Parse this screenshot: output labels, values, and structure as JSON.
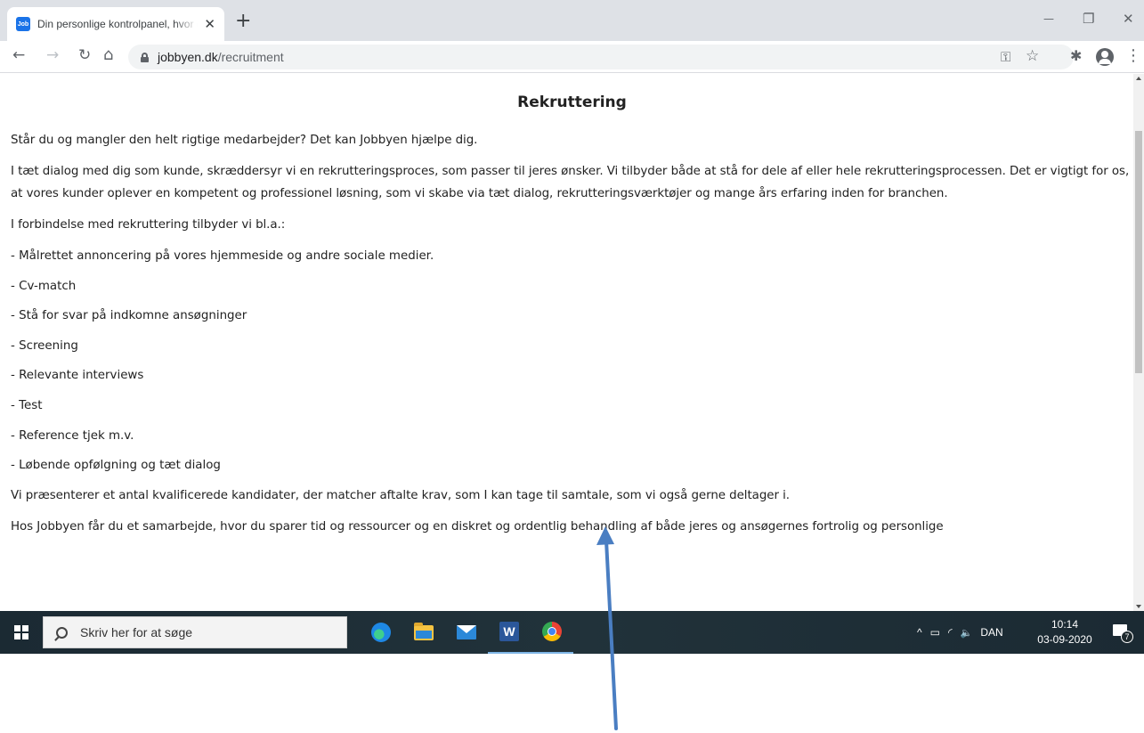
{
  "browser": {
    "tab": {
      "favicon_text": "Job",
      "title": "Din personlige kontrolpanel, hvor du kan",
      "close_glyph": "✕"
    },
    "new_tab_glyph": "+",
    "window_controls": {
      "minimize": "—",
      "restore": "❐",
      "close": "✕"
    },
    "toolbar": {
      "back_glyph": "←",
      "forward_glyph": "→",
      "reload_glyph": "↻",
      "home_glyph": "⌂",
      "url_domain": "jobbyen.dk",
      "url_path": "/recruitment",
      "key_glyph": "⚿",
      "star_glyph": "☆",
      "extensions_glyph": "✱",
      "menu_glyph": "⋮"
    }
  },
  "page": {
    "title": "Rekruttering",
    "intro": "Står du og mangler den helt rigtige medarbejder? Det kan Jobbyen hjælpe dig.",
    "description": "I tæt dialog med dig som kunde, skræddersyr vi en rekrutteringsproces, som passer til jeres ønsker. Vi tilbyder både at stå for dele af eller hele rekrutteringsprocessen. Det er vigtigt for os, at vores kunder oplever en kompetent og professionel løsning, som vi skabe via tæt dialog, rekrutteringsværktøjer og mange års erfaring inden for branchen.",
    "services_heading": "I forbindelse med rekruttering tilbyder vi bl.a.:",
    "services": [
      "- Målrettet annoncering på vores hjemmeside og andre sociale medier.",
      "- Cv-match",
      "- Stå for svar på indkomne ansøgninger",
      "- Screening",
      "- Relevante interviews",
      "- Test",
      "- Reference tjek m.v.",
      "- Løbende opfølgning og tæt dialog"
    ],
    "candidates": "Vi præsenterer et antal kvalificerede kandidater, der matcher aftalte krav, som I kan tage til samtale, som vi også gerne deltager i.",
    "collaboration": "Hos Jobbyen får du et samarbejde, hvor du sparer tid og ressourcer og en diskret og ordentlig behandling af både jeres og ansøgernes fortrolig og personlige"
  },
  "taskbar": {
    "search_placeholder": "Skriv her for at søge",
    "word_letter": "W",
    "tray": {
      "chevron": "^",
      "network": "▭",
      "wifi": "◜",
      "volume": "🔈",
      "language": "DAN"
    },
    "time": "10:14",
    "date": "03-09-2020",
    "notification_count": "7"
  },
  "colors": {
    "annotation_arrow": "#4a7ec2",
    "taskbar_bg": "#1f2a2e",
    "tabbar_bg": "#dee1e6"
  }
}
